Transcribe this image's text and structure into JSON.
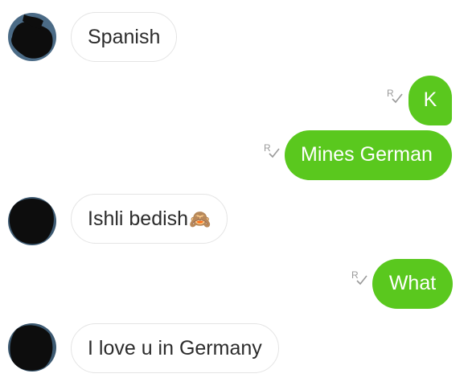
{
  "messages": [
    {
      "side": "in",
      "text": "Spanish"
    },
    {
      "side": "out",
      "text": "K",
      "receipt": "read-receipt-icon"
    },
    {
      "side": "out",
      "text": "Mines German",
      "receipt": "read-receipt-icon"
    },
    {
      "side": "in",
      "text": "Ishli bedish",
      "emoji": "🙈"
    },
    {
      "side": "out",
      "text": "What",
      "receipt": "read-receipt-icon"
    },
    {
      "side": "in",
      "text": "I love u in Germany"
    }
  ],
  "colors": {
    "outgoing_bubble": "#5ac81e",
    "incoming_bubble": "#ffffff",
    "incoming_border": "#e4e4e4",
    "receipt_icon": "#9a9a9a"
  },
  "icons": {
    "avatar": "avatar-redacted",
    "receipt": "read-receipt-icon"
  }
}
